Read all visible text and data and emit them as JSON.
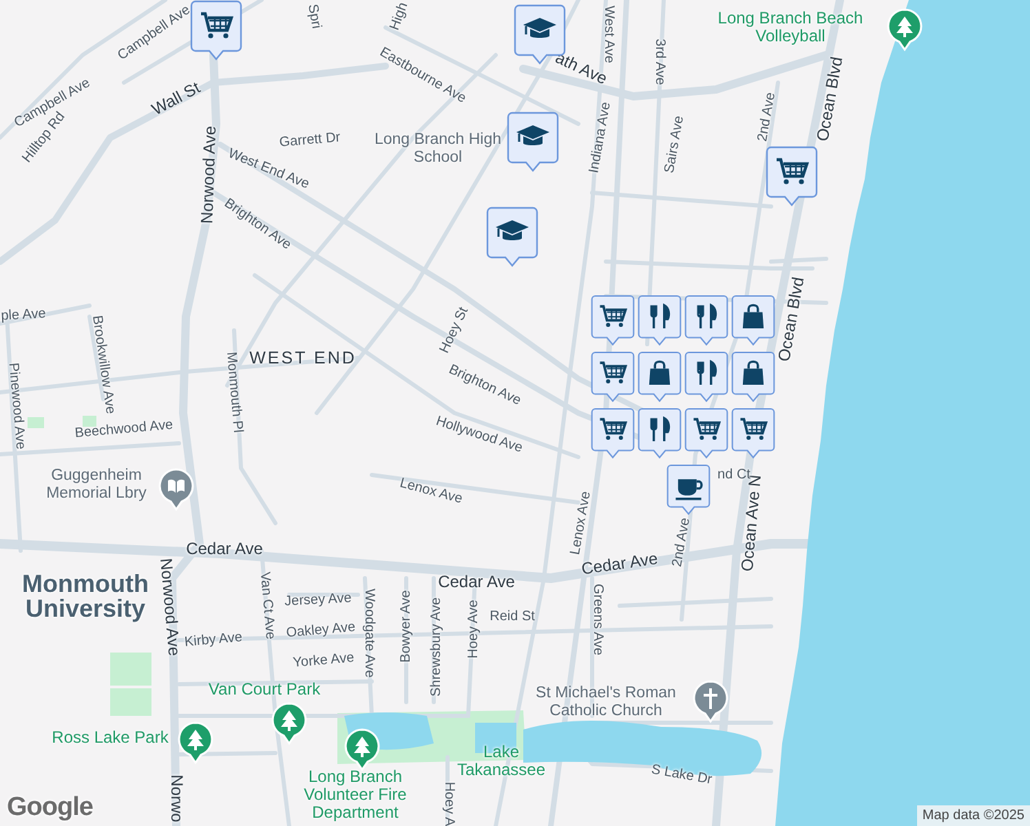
{
  "map": {
    "labels": [
      {
        "text": "Campbell Ave",
        "kind": "street"
      },
      {
        "text": "Campbell Ave",
        "kind": "street"
      },
      {
        "text": "Hilltop Rd",
        "kind": "street"
      },
      {
        "text": "Wall St",
        "kind": "major"
      },
      {
        "text": "Norwood Ave",
        "kind": "major"
      },
      {
        "text": "Garrett Dr",
        "kind": "street"
      },
      {
        "text": "West End Ave",
        "kind": "street"
      },
      {
        "text": "Eastbourne Ave",
        "kind": "street"
      },
      {
        "text": "Brighton Ave",
        "kind": "street"
      },
      {
        "text": "Hoey St",
        "kind": "street"
      },
      {
        "text": "Brighton Ave",
        "kind": "street"
      },
      {
        "text": "WEST END",
        "kind": "district"
      },
      {
        "text": "ple Ave",
        "kind": "street"
      },
      {
        "text": "Brookwillow Ave",
        "kind": "street"
      },
      {
        "text": "Pinewood Ave",
        "kind": "street"
      },
      {
        "text": "Monmouth Pl",
        "kind": "street"
      },
      {
        "text": "Beechwood Ave",
        "kind": "street"
      },
      {
        "text": "Hollywood Ave",
        "kind": "street"
      },
      {
        "text": "Guggenheim Memorial Lbry",
        "kind": "place"
      },
      {
        "text": "Lenox Ave",
        "kind": "street"
      },
      {
        "text": "Cedar Ave",
        "kind": "major"
      },
      {
        "text": "Cedar Ave",
        "kind": "major"
      },
      {
        "text": "Cedar Ave",
        "kind": "major"
      },
      {
        "text": "Monmouth University",
        "kind": "campus"
      },
      {
        "text": "Norwood Ave",
        "kind": "major"
      },
      {
        "text": "Van Ct Ave",
        "kind": "street"
      },
      {
        "text": "Jersey Ave",
        "kind": "street"
      },
      {
        "text": "Kirby Ave",
        "kind": "street"
      },
      {
        "text": "Oakley Ave",
        "kind": "street"
      },
      {
        "text": "Woodgate Ave",
        "kind": "street"
      },
      {
        "text": "Bowyer Ave",
        "kind": "street"
      },
      {
        "text": "Shrewsbury Ave",
        "kind": "street"
      },
      {
        "text": "Hoey Ave",
        "kind": "street"
      },
      {
        "text": "Reid St",
        "kind": "street"
      },
      {
        "text": "Yorke Ave",
        "kind": "street"
      },
      {
        "text": "Van Court Park",
        "kind": "park"
      },
      {
        "text": "Ross Lake Park",
        "kind": "park"
      },
      {
        "text": "Long Branch Volunteer Fire Department",
        "kind": "park"
      },
      {
        "text": "Lake Takanassee",
        "kind": "park"
      },
      {
        "text": "Hoey A",
        "kind": "street"
      },
      {
        "text": "Norwo",
        "kind": "major"
      },
      {
        "text": "Lenox Ave",
        "kind": "street"
      },
      {
        "text": "Greens Ave",
        "kind": "street"
      },
      {
        "text": "2nd Ave",
        "kind": "street"
      },
      {
        "text": "Ocean Ave N",
        "kind": "major"
      },
      {
        "text": "St Michael's Roman Catholic Church",
        "kind": "place"
      },
      {
        "text": "S Lake Dr",
        "kind": "street"
      },
      {
        "text": "nd Ct",
        "kind": "street"
      },
      {
        "text": "Ocean Blvd",
        "kind": "major"
      },
      {
        "text": "Ocean Blvd",
        "kind": "major"
      },
      {
        "text": "2nd Ave",
        "kind": "street"
      },
      {
        "text": "Sairs Ave",
        "kind": "street"
      },
      {
        "text": "3rd Ave",
        "kind": "street"
      },
      {
        "text": "Indiana Ave",
        "kind": "street"
      },
      {
        "text": "West Ave",
        "kind": "street"
      },
      {
        "text": "ath Ave",
        "kind": "major"
      },
      {
        "text": "Long Branch High School",
        "kind": "place"
      },
      {
        "text": "Long Branch Beach Volleyball",
        "kind": "park"
      },
      {
        "text": "Spri",
        "kind": "street"
      },
      {
        "text": "High",
        "kind": "street"
      }
    ],
    "pins": [
      {
        "kind": "shop"
      },
      {
        "kind": "school"
      },
      {
        "kind": "school"
      },
      {
        "kind": "school"
      },
      {
        "kind": "shop"
      },
      {
        "kind": "food"
      },
      {
        "kind": "food"
      },
      {
        "kind": "shop"
      },
      {
        "kind": "food"
      },
      {
        "kind": "bag"
      },
      {
        "kind": "bag"
      },
      {
        "kind": "shop"
      },
      {
        "kind": "food"
      },
      {
        "kind": "bag"
      },
      {
        "kind": "shop"
      },
      {
        "kind": "shop"
      },
      {
        "kind": "shop"
      },
      {
        "kind": "coffee"
      },
      {
        "kind": "park"
      },
      {
        "kind": "library"
      },
      {
        "kind": "park"
      },
      {
        "kind": "park"
      },
      {
        "kind": "park"
      },
      {
        "kind": "church"
      }
    ],
    "logo": "Google",
    "attribution": "Map data ©2025"
  }
}
